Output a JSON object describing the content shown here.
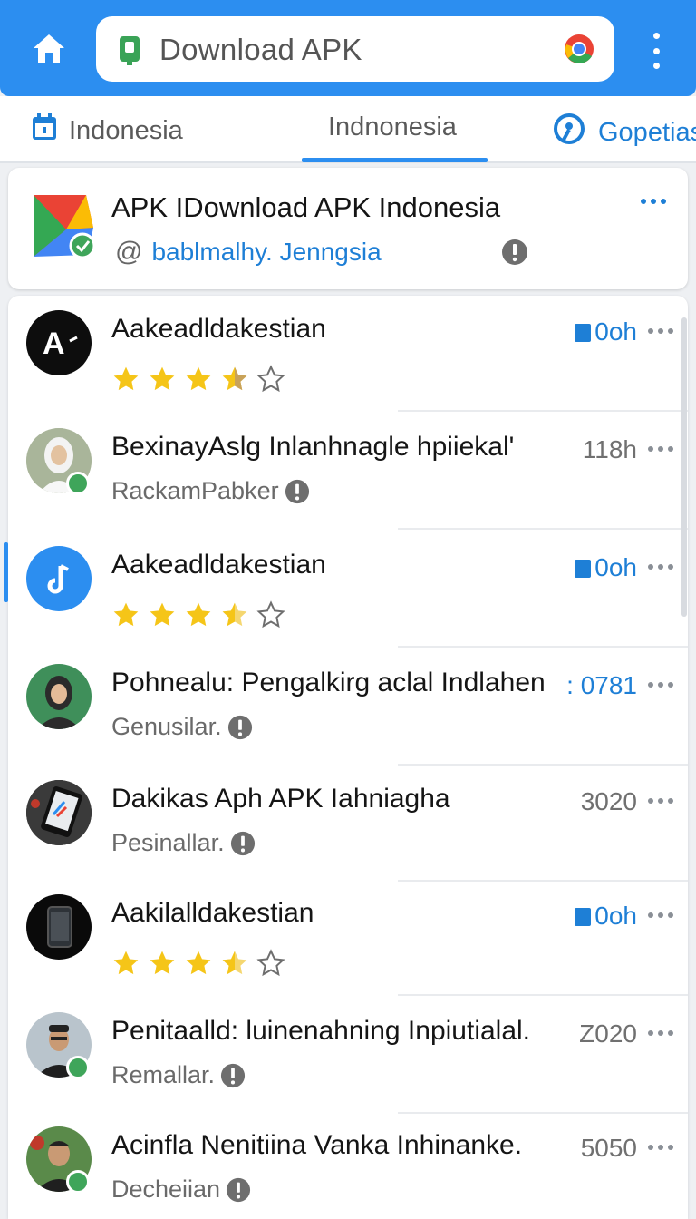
{
  "topbar": {
    "home_icon": "home-icon",
    "url_text": "Download APK",
    "lock_icon": "lock-icon",
    "browser_icon": "chrome-icon",
    "more_icon": "more-vert-icon",
    "color": "#2c8ef0"
  },
  "tabs": [
    {
      "label": "Indonesia",
      "icon": "calendar-icon"
    },
    {
      "label": "Indnonesia",
      "active": true
    },
    {
      "label": "Gopetias",
      "icon": "location-icon"
    }
  ],
  "app": {
    "title": "APK IDownload APK Indonesia",
    "handle_prefix": "@",
    "handle": "bablmalhy. Jenngsia"
  },
  "list": [
    {
      "title": "Aakeadldakestian",
      "rating": 3.5,
      "meta": "0oh",
      "meta_style": "blue-check",
      "avatar": "apk-a-logo"
    },
    {
      "title": "BexinayAslg Inlanhnagle hpiiekal'",
      "sub": "RackamPabker",
      "meta": "118h",
      "avatar": "person-avatar"
    },
    {
      "title": "Aakeadldakestian",
      "rating": 3.5,
      "meta": "0oh",
      "meta_style": "blue-check",
      "avatar": "music-app-icon"
    },
    {
      "title": "Pohnealu: Pengalkirg aclal Indlahen",
      "sub": "Genusilar.",
      "meta": ": 0781",
      "meta_style": "blue",
      "avatar": "person-avatar"
    },
    {
      "title": "Dakikas Aph APK Iahniagha",
      "sub": "Pesinallar.",
      "meta": "3020",
      "avatar": "phone-app-icon"
    },
    {
      "title": "Aakilalldakestian",
      "rating": 3.5,
      "meta": "0oh",
      "meta_style": "blue-check",
      "avatar": "phone-icon"
    },
    {
      "title": "Penitaalld: luinenahning Inpiutialal.",
      "sub": "Remallar.",
      "meta": "Z020",
      "avatar": "person-avatar"
    },
    {
      "title": "Acinfla Nenitiina Vanka Inhinanke.",
      "sub": "Decheiian",
      "meta": "5050",
      "avatar": "person-avatar"
    }
  ]
}
